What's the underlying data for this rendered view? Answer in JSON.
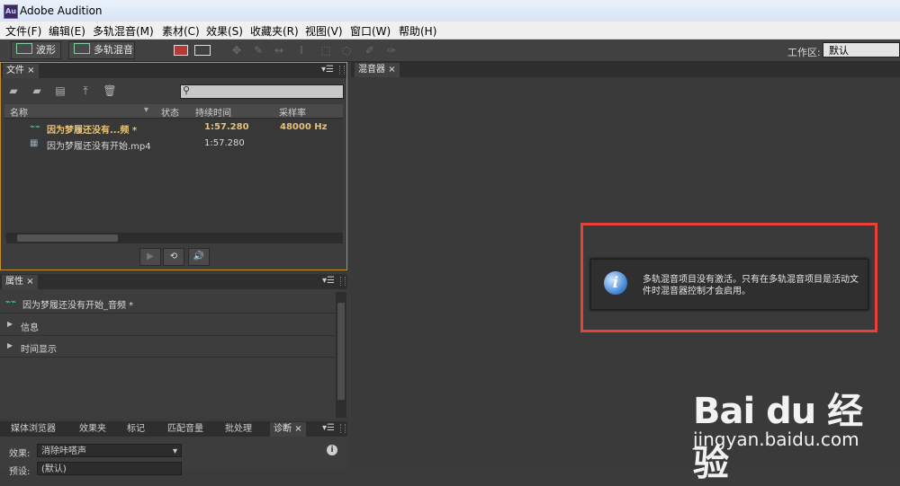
{
  "window": {
    "icon_text": "Au",
    "title": "Adobe Audition"
  },
  "menubar": [
    "文件(F)",
    "编辑(E)",
    "多轨混音(M)",
    "素材(C)",
    "效果(S)",
    "收藏夹(R)",
    "视图(V)",
    "窗口(W)",
    "帮助(H)"
  ],
  "toolbar": {
    "waveform_label": "波形",
    "multitrack_label": "多轨混音",
    "workspace_label": "工作区:",
    "workspace_value": "默认"
  },
  "files_panel": {
    "tab_label": "文件",
    "columns": [
      "名称",
      "状态",
      "持续时间",
      "采样率"
    ],
    "rows": [
      {
        "name": "因为梦履还没有...频 *",
        "status": "",
        "duration": "1:57.280",
        "sample_rate": "48000 Hz",
        "selected": true,
        "icon": "audio-waveform-icon"
      },
      {
        "name": "因为梦履还没有开始.mp4",
        "status": "",
        "duration": "1:57.280",
        "sample_rate": "",
        "selected": false,
        "icon": "video-file-icon"
      }
    ]
  },
  "properties_panel": {
    "tab_label": "属性",
    "item_name": "因为梦履还没有开始_音频 *",
    "sections": [
      "信息",
      "时间显示"
    ]
  },
  "bottom_tabs": [
    "媒体浏览器",
    "效果夹",
    "标记",
    "匹配音量",
    "批处理",
    "诊断"
  ],
  "effects": {
    "effect_label": "效果:",
    "effect_value": "消除咔嗒声",
    "preset_label": "预设:",
    "preset_value": "(默认)"
  },
  "mixer_panel": {
    "tab_label": "混音器",
    "message": "多轨混音项目没有激活。只有在多轨混音项目是活动文件时混音器控制才会启用。"
  },
  "watermark": {
    "brand": "Bai du 经验",
    "url": "jingyan.baidu.com"
  },
  "colors": {
    "highlight": "#e8413a",
    "selected_text": "#e5c27a",
    "panel_border_active": "#c28f2c"
  }
}
